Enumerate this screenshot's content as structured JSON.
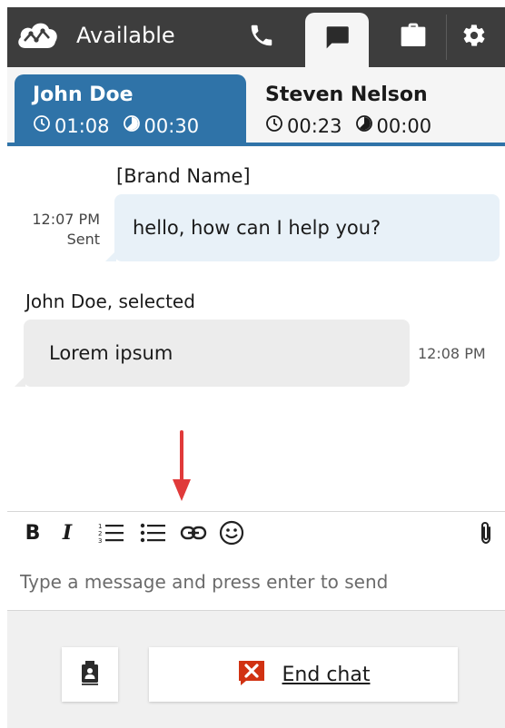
{
  "header": {
    "status_label": "Available",
    "nav": [
      {
        "name": "phone",
        "icon": "phone-icon",
        "active": false
      },
      {
        "name": "chat",
        "icon": "chat-icon",
        "active": true
      },
      {
        "name": "queues",
        "icon": "briefcase-icon",
        "active": false
      },
      {
        "name": "settings",
        "icon": "gear-icon",
        "active": false
      }
    ]
  },
  "contacts": [
    {
      "name": "John Doe",
      "elapsed": "01:08",
      "wait": "00:30",
      "active": true
    },
    {
      "name": "Steven Nelson",
      "elapsed": "00:23",
      "wait": "00:00",
      "active": false
    }
  ],
  "conversation": {
    "agent_sender": "[Brand Name]",
    "agent_time": "12:07 PM",
    "agent_status": "Sent",
    "agent_message": "hello, how can I help you?",
    "customer_label": "John Doe, selected",
    "customer_message": "Lorem ipsum",
    "customer_time": "12:08 PM"
  },
  "composer": {
    "toolbar": [
      "bold-icon",
      "italic-icon",
      "numbered-list-icon",
      "bulleted-list-icon",
      "link-icon",
      "emoji-icon",
      "attachment-icon"
    ],
    "bold_label": "B",
    "italic_label": "I",
    "placeholder": "Type a message and press enter to send"
  },
  "footer": {
    "end_chat_label": "End chat"
  },
  "colors": {
    "topbar": "#3d3d3d",
    "accent": "#2f73a8",
    "danger": "#d13212",
    "arrow": "#e03a3a"
  }
}
